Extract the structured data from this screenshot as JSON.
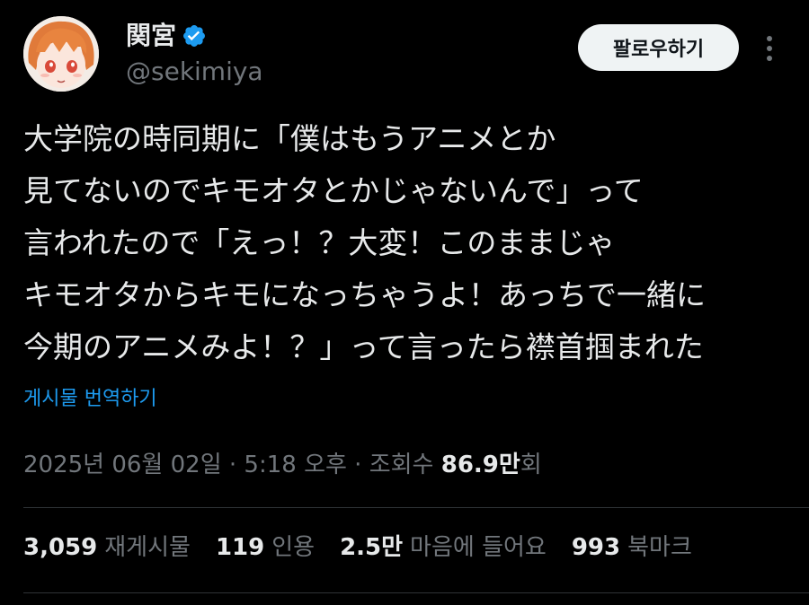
{
  "colors": {
    "background": "#000000",
    "text_primary": "#e7e9ea",
    "text_secondary": "#71767b",
    "link": "#1d9bf0",
    "verified_badge": "#1d9bf0",
    "follow_button_bg": "#eff3f4",
    "divider": "#2f3336"
  },
  "author": {
    "avatar_icon": "anime-girl-avatar",
    "display_name": "関宮",
    "verified_icon": "verified-badge-icon",
    "handle": "@sekimiya"
  },
  "actions": {
    "follow_label": "팔로우하기",
    "more_icon": "more-vertical-icon"
  },
  "tweet": {
    "lines": [
      "大学院の時同期に「僕はもうアニメとか",
      "見てないのでキモオタとかじゃないんで」って",
      "言われたので「えっ！？大変！このままじゃ",
      "キモオタからキモになっちゃうよ！あっちで一緒に",
      "今期のアニメみよ！？」って言ったら襟首掴まれた"
    ],
    "translate_label": "게시물 번역하기"
  },
  "meta": {
    "timestamp": "2025년 06월 02일 · 5:18 오후 · 조회수",
    "views_count": "86.9만",
    "views_suffix": "회"
  },
  "stats": {
    "reposts_count": "3,059",
    "reposts_label": "재게시물",
    "quotes_count": "119",
    "quotes_label": "인용",
    "likes_count": "2.5만",
    "likes_label": "마음에 들어요",
    "bookmarks_count": "993",
    "bookmarks_label": "북마크"
  }
}
